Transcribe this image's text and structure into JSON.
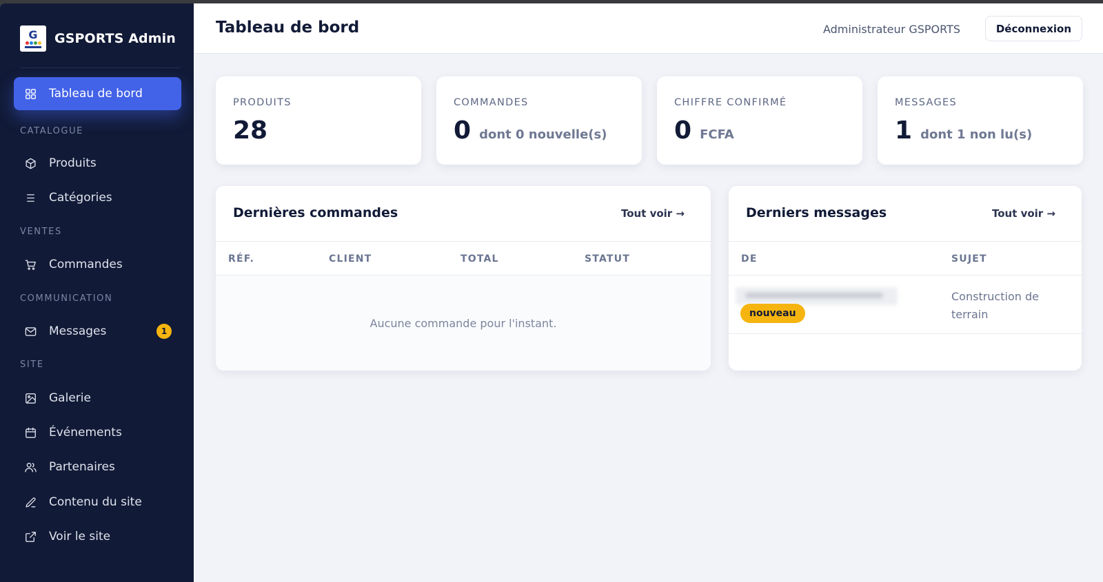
{
  "sidebar": {
    "brand": "GSPORTS Admin",
    "active_item": "Tableau de bord",
    "sections": {
      "catalogue": "CATALOGUE",
      "ventes": "VENTES",
      "communication": "COMMUNICATION",
      "site": "SITE"
    },
    "items": {
      "dashboard": "Tableau de bord",
      "products": "Produits",
      "categories": "Catégories",
      "orders": "Commandes",
      "messages": "Messages",
      "messages_badge": "1",
      "gallery": "Galerie",
      "events": "Événements",
      "partners": "Partenaires",
      "site_content": "Contenu du site",
      "view_site": "Voir le site"
    }
  },
  "header": {
    "title": "Tableau de bord",
    "user": "Administrateur GSPORTS",
    "logout": "Déconnexion"
  },
  "stats": {
    "products": {
      "label": "PRODUITS",
      "value": "28",
      "suffix": ""
    },
    "orders": {
      "label": "COMMANDES",
      "value": "0",
      "suffix": "dont 0 nouvelle(s)"
    },
    "revenue": {
      "label": "CHIFFRE CONFIRMÉ",
      "value": "0",
      "suffix": "FCFA"
    },
    "messages": {
      "label": "MESSAGES",
      "value": "1",
      "suffix": "dont 1 non lu(s)"
    }
  },
  "orders_panel": {
    "title": "Dernières commandes",
    "see_all": "Tout voir →",
    "columns": [
      "RÉF.",
      "CLIENT",
      "TOTAL",
      "STATUT"
    ],
    "empty": "Aucune commande pour l'instant."
  },
  "messages_panel": {
    "title": "Derniers messages",
    "see_all": "Tout voir →",
    "columns": [
      "DE",
      "SUJET"
    ],
    "rows": [
      {
        "badge": "nouveau",
        "subject": "Construction de terrain"
      }
    ]
  },
  "colors": {
    "sidebar_bg": "#111a36",
    "accent": "#4262e8",
    "badge": "#f5b40f",
    "page_bg": "#f1f3f8"
  }
}
